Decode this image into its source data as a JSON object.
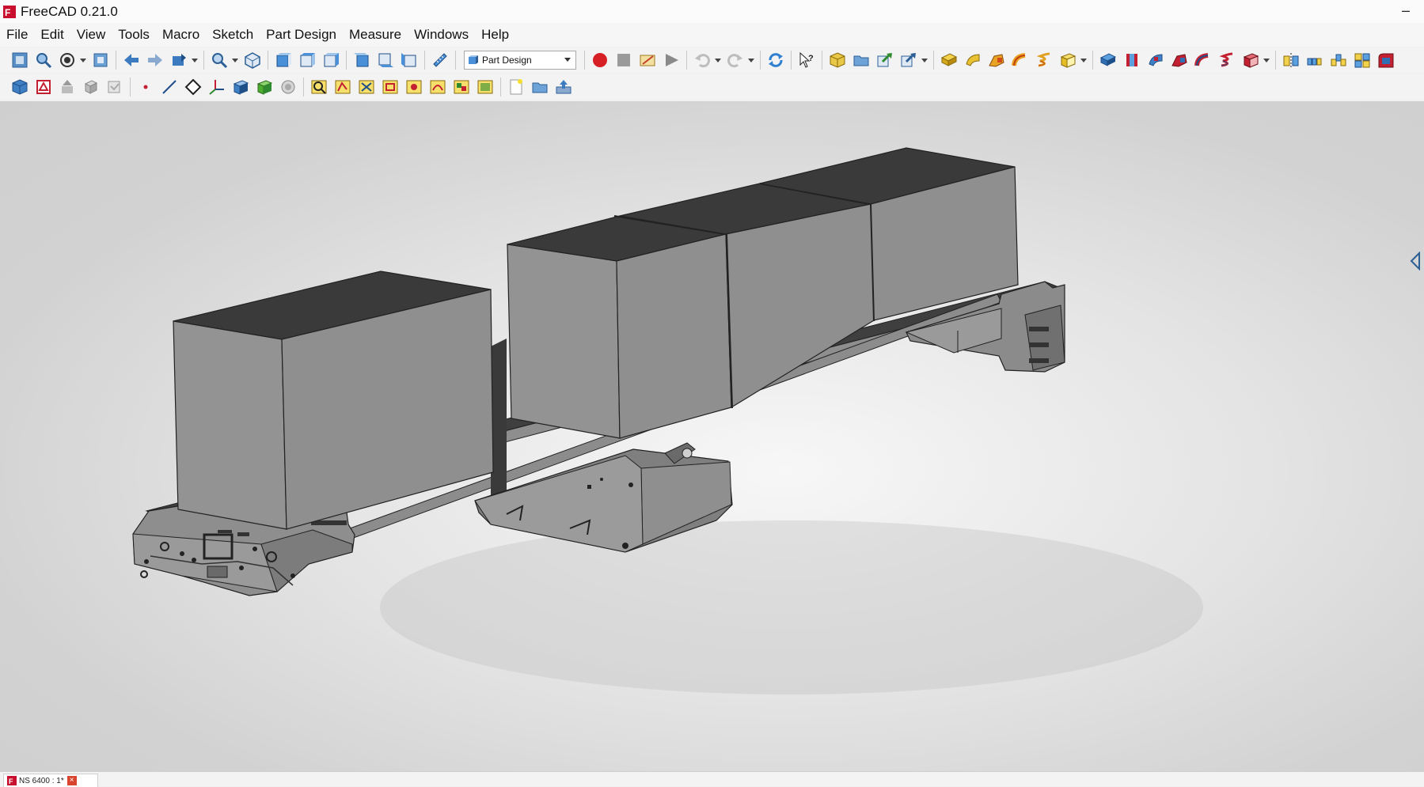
{
  "window": {
    "title": "FreeCAD 0.21.0",
    "minimize_glyph": "–"
  },
  "menu": [
    "File",
    "Edit",
    "View",
    "Tools",
    "Macro",
    "Sketch",
    "Part Design",
    "Measure",
    "Windows",
    "Help"
  ],
  "toolbar": {
    "workbench_selector": "Part Design",
    "row1_icons": [
      "fit-all-icon",
      "fit-selection-icon",
      "draw-style-icon",
      "bounding-box-icon",
      "back-icon",
      "forward-icon",
      "sync-view-icon",
      "zoom-icon",
      "isometric-view-icon",
      "front-view-icon",
      "top-view-icon",
      "right-view-icon",
      "rear-view-icon",
      "bottom-view-icon",
      "left-view-icon",
      "measure-icon",
      "macro-record-icon",
      "macro-stop-icon",
      "macro-edit-icon",
      "macro-execute-icon",
      "undo-icon",
      "redo-icon",
      "refresh-icon",
      "whats-this-icon",
      "create-body-icon",
      "create-group-icon",
      "create-link-icon",
      "make-link-actions-icon",
      "pad-icon",
      "revolution-icon",
      "additive-loft-icon",
      "additive-pipe-icon",
      "additive-helix-icon",
      "additive-primitive-icon",
      "pocket-icon",
      "hole-icon",
      "groove-icon",
      "subtractive-loft-icon",
      "subtractive-pipe-icon",
      "subtractive-helix-icon",
      "subtractive-primitive-icon",
      "mirrored-icon",
      "linear-pattern-icon",
      "polar-pattern-icon",
      "multitransform-icon",
      "fillet-icon"
    ],
    "row2_icons": [
      "create-body-icon",
      "create-sketch-icon",
      "validate-sketch-icon",
      "shape-binder-icon",
      "clone-icon",
      "datum-point-icon",
      "datum-line-icon",
      "datum-plane-icon",
      "local-coordinate-system-icon",
      "sub-shape-binder-icon",
      "shape-binder-green-icon",
      "view-sketch-icon",
      "map-sketch-icon",
      "sketch-to-body-icon",
      "create-sketch-alt-icon",
      "edit-sketch-icon",
      "reorient-sketch-icon",
      "merge-sketches-icon",
      "mirror-sketch-icon",
      "new-document-icon",
      "open-document-icon",
      "save-document-icon"
    ]
  },
  "colors": {
    "box_top": "#3a3a3a",
    "box_front": "#8f8f8f",
    "box_side": "#7a7a7a",
    "frame_top": "#444444",
    "frame_side": "#8a8a8a",
    "accent_record": "#d71f26",
    "close_tab": "#d9442e"
  },
  "document_tab": {
    "label": "NS 6400 : 1*",
    "close_glyph": "×"
  }
}
